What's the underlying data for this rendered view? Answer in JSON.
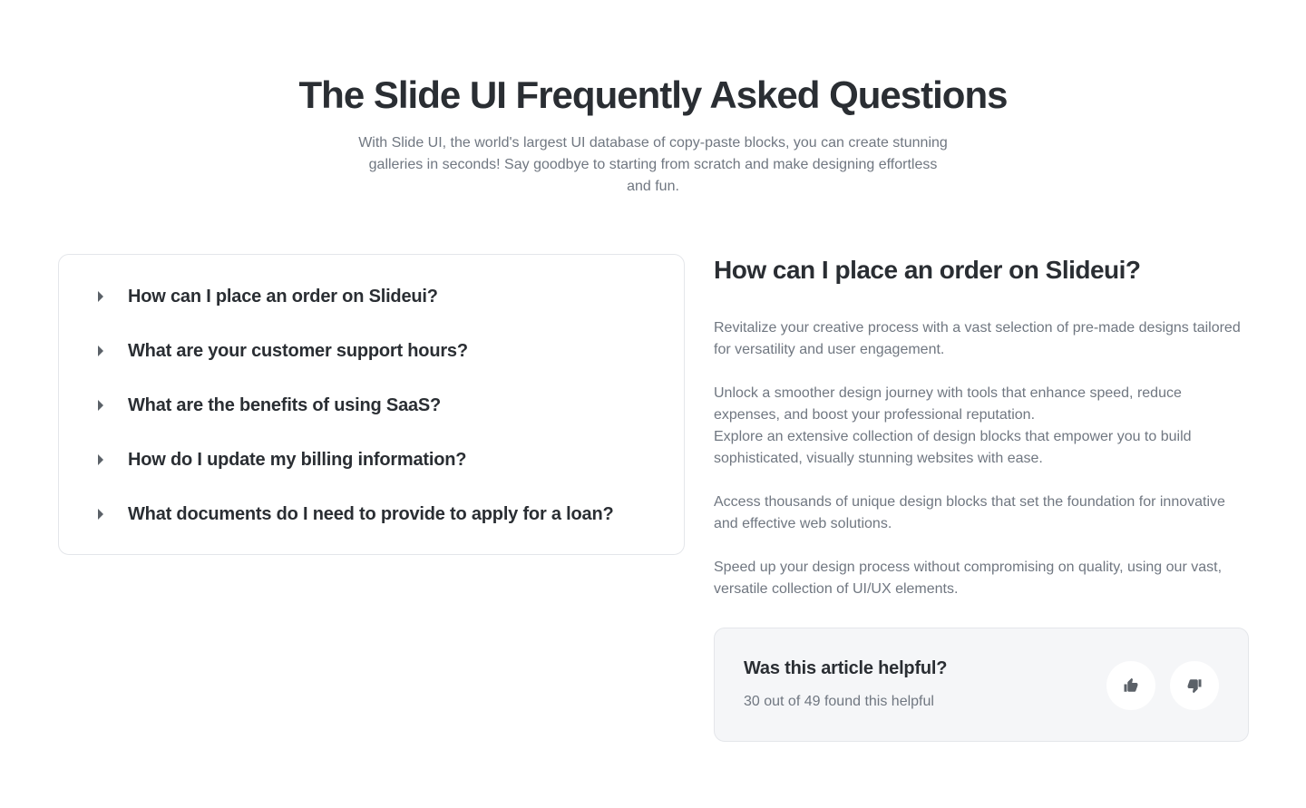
{
  "header": {
    "title": "The Slide UI Frequently Asked Questions",
    "subtitle": "With Slide UI, the world's largest UI database of copy-paste blocks, you can create stunning galleries in seconds! Say goodbye to starting from scratch and make designing effortless and fun."
  },
  "faq": {
    "items": [
      {
        "question": "How can I place an order on Slideui?"
      },
      {
        "question": "What are your customer support hours?"
      },
      {
        "question": "What are the benefits of using SaaS?"
      },
      {
        "question": "How do I update my billing information?"
      },
      {
        "question": "What documents do I need to provide to apply for a loan?"
      }
    ]
  },
  "answer": {
    "title": "How can I place an order on Slideui?",
    "paragraphs": [
      "Revitalize your creative process with a vast selection of pre-made designs tailored for versatility and user engagement.",
      "Unlock a smoother design journey with tools that enhance speed, reduce expenses, and boost your professional reputation.",
      "Explore an extensive collection of design blocks that empower you to build sophisticated, visually stunning websites with ease.",
      "Access thousands of unique design blocks that set the foundation for innovative and effective web solutions.",
      "Speed up your design process without compromising on quality, using our vast, versatile collection of UI/UX elements."
    ]
  },
  "feedback": {
    "question": "Was this article helpful?",
    "count_text": "30 out of 49 found this helpful",
    "up_icon": "thumbs-up-icon",
    "down_icon": "thumbs-down-icon"
  },
  "colors": {
    "heading": "#2a2e33",
    "muted": "#707781",
    "border": "#e4e6ea",
    "card_bg": "#f5f6f8",
    "icon": "#5b6168"
  }
}
